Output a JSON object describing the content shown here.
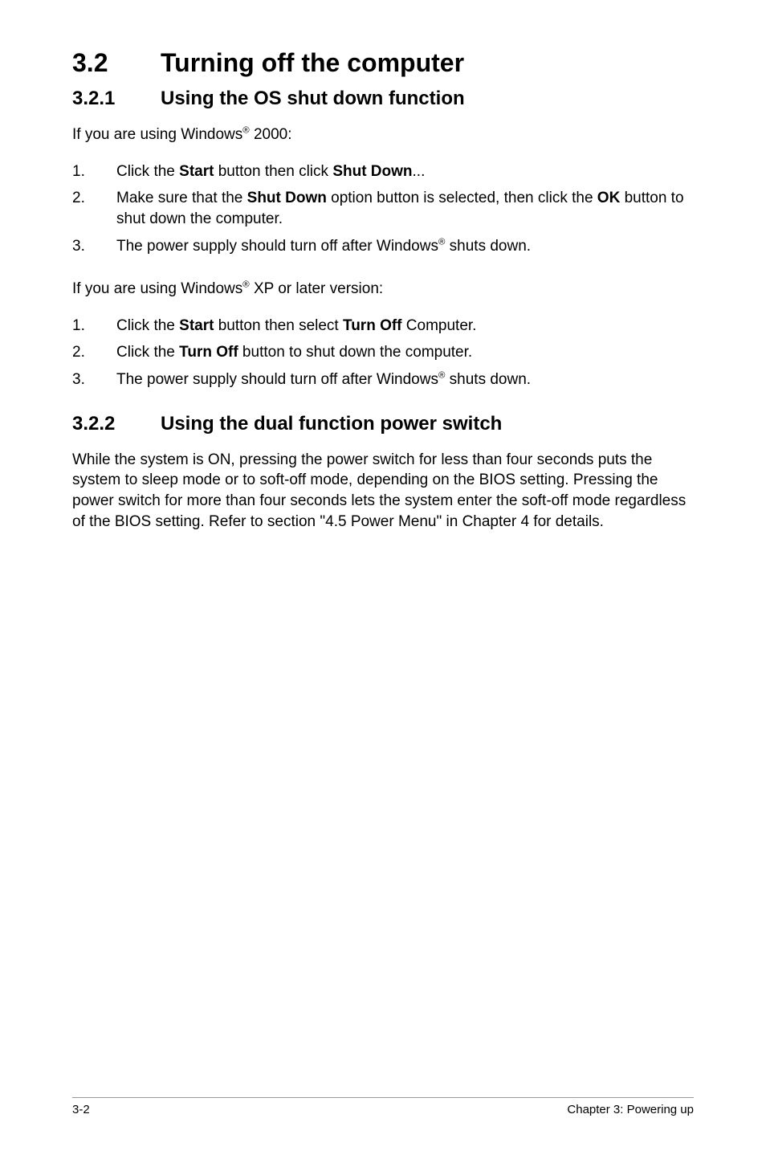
{
  "heading": {
    "number": "3.2",
    "title": "Turning off the computer"
  },
  "section321": {
    "number": "3.2.1",
    "title": "Using the OS shut down function",
    "intro_2000_prefix": "If you are using Windows",
    "intro_2000_suffix": " 2000:",
    "steps_2000": [
      {
        "pre": "Click the ",
        "b1": "Start",
        "mid": " button then click ",
        "b2": "Shut Down",
        "post": "..."
      },
      {
        "pre": "Make sure that the ",
        "b1": "Shut Down",
        "mid": " option button is selected, then click the ",
        "b2": "OK",
        "post": " button to shut down the computer."
      },
      {
        "pre": "The power supply should turn off after Windows",
        "sup": "®",
        "post": " shuts down."
      }
    ],
    "intro_xp_prefix": "If you are using Windows",
    "intro_xp_suffix": " XP or later version:",
    "steps_xp": [
      {
        "pre": "Click the ",
        "b1": "Start",
        "mid": " button then select ",
        "b2": "Turn Off",
        "post": " Computer."
      },
      {
        "pre": "Click the ",
        "b1": "Turn Off",
        "post": " button to shut down the computer."
      },
      {
        "pre": "The power supply should turn off after Windows",
        "sup": "®",
        "post": " shuts down."
      }
    ]
  },
  "section322": {
    "number": "3.2.2",
    "title": "Using the dual function power switch",
    "para": "While the system is ON, pressing the power switch for less than four seconds puts the system to sleep mode or to soft-off mode, depending on the BIOS setting. Pressing the power switch for more than four seconds lets the system enter the soft-off mode regardless of the BIOS setting. Refer to section  \"4.5  Power Menu\" in Chapter 4 for details."
  },
  "footer": {
    "page": "3-2",
    "chapter": "Chapter 3: Powering up"
  },
  "reg": "®"
}
